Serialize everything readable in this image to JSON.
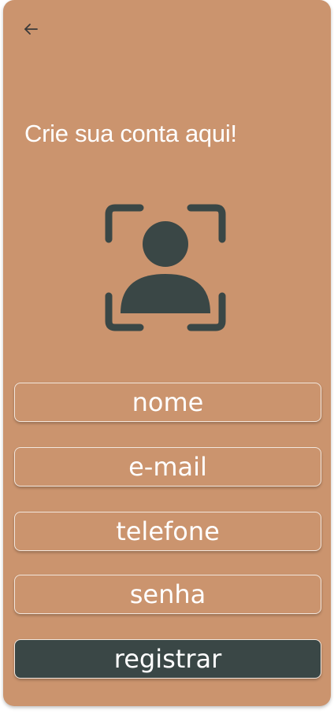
{
  "header": {
    "back_icon": "arrow-left-icon",
    "title": "Crie sua conta aqui!"
  },
  "avatar": {
    "icon": "face-scan-user-icon",
    "color": "#3a4746"
  },
  "form": {
    "name_placeholder": "nome",
    "email_placeholder": "e-mail",
    "phone_placeholder": "telefone",
    "password_placeholder": "senha"
  },
  "actions": {
    "register_label": "registrar"
  },
  "colors": {
    "background": "#cb946e",
    "accent_dark": "#3a4746",
    "text": "#ffffff"
  }
}
